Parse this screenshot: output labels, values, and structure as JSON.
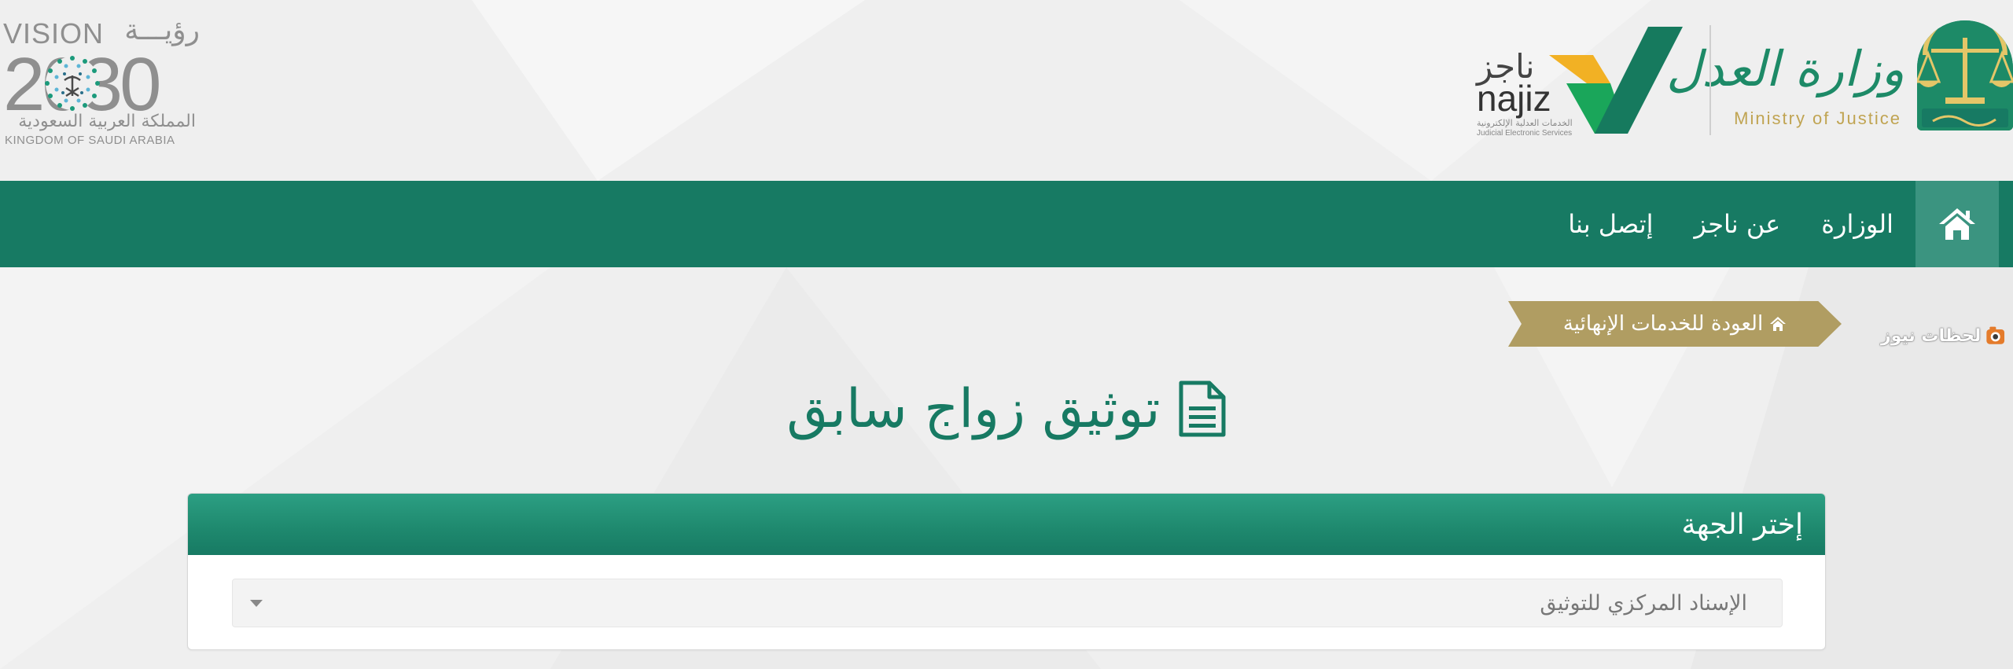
{
  "colors": {
    "primary_green": "#177a63",
    "nav_home_bg": "#3b9480",
    "gold": "#b09d62",
    "moj_green": "#1d8a67",
    "moj_gold": "#c0a452",
    "najiz_yellow": "#f2b124",
    "najiz_green": "#1aa65a",
    "najiz_dark_green": "#167a5e"
  },
  "header": {
    "moj_logo": {
      "arabic_name": "وزارة العدل",
      "english_name": "Ministry of Justice",
      "icon": "scales-of-justice-icon"
    },
    "najiz_logo": {
      "arabic_name": "ناجز",
      "english_name": "najiz",
      "arabic_subtitle": "الخدمات العدلية الإلكترونية",
      "english_subtitle": "Judicial Electronic Services",
      "icon": "najiz-check-mark-icon"
    },
    "vision_logo": {
      "english_title": "VISION",
      "arabic_title": "رؤيـــة",
      "year": "2030",
      "kingdom_ar": "المملكة العربية السعودية",
      "kingdom_en": "KINGDOM OF SAUDI ARABIA"
    }
  },
  "nav": {
    "home_icon": "home-icon",
    "items": [
      {
        "label": "الوزارة"
      },
      {
        "label": "عن ناجز"
      },
      {
        "label": "إتصل بنا"
      }
    ]
  },
  "back_link": {
    "label": "العودة للخدمات الإنهائية",
    "icon": "home-icon"
  },
  "news_badge": {
    "label": "لحظات نيوز",
    "icon": "camera-icon"
  },
  "page": {
    "title": "توثيق زواج سابق",
    "title_icon": "document-icon"
  },
  "panel": {
    "title": "إختر الجهة",
    "select": {
      "value": "الإسناد المركزي للتوثيق"
    }
  }
}
